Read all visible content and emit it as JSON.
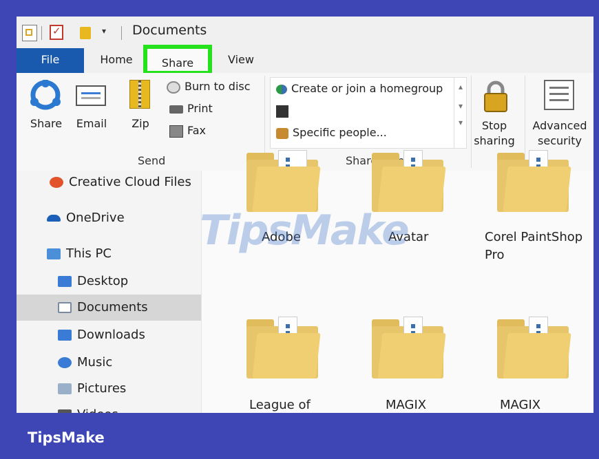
{
  "title": "Documents",
  "tabs": {
    "file": "File",
    "home": "Home",
    "share": "Share",
    "view": "View"
  },
  "ribbon": {
    "share": "Share",
    "email": "Email",
    "zip": "Zip",
    "burn": "Burn to disc",
    "print": "Print",
    "fax": "Fax",
    "send_group": "Send",
    "homegroup": "Create or join a homegroup",
    "specific": "Specific people...",
    "sharewith_group": "Share with",
    "stop1": "Stop",
    "stop2": "sharing",
    "adv1": "Advanced",
    "adv2": "security"
  },
  "nav": {
    "creative": "Creative Cloud Files",
    "onedrive": "OneDrive",
    "thispc": "This PC",
    "desktop": "Desktop",
    "documents": "Documents",
    "downloads": "Downloads",
    "music": "Music",
    "pictures": "Pictures",
    "videos": "Videos"
  },
  "folders": {
    "adobe": "Adobe",
    "avatar": "Avatar",
    "corel1": "Corel PaintShop",
    "corel2": "Pro",
    "league": "League of",
    "magix1": "MAGIX",
    "magix2": "MAGIX"
  },
  "watermark": "TipsMake",
  "brand": "TipsMake"
}
